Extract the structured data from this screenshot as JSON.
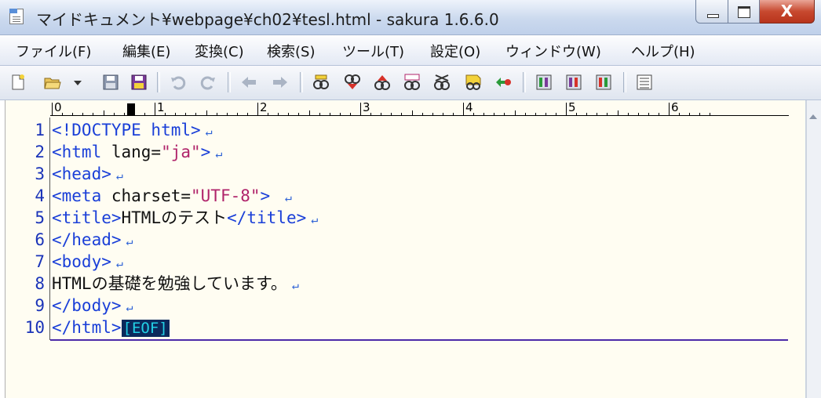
{
  "window": {
    "title": "マイドキュメント¥webpage¥ch02¥tesl.html - sakura 1.6.6.0",
    "close_glyph": "X"
  },
  "menu": [
    {
      "label": "ファイル(F)"
    },
    {
      "label": "編集(E)"
    },
    {
      "label": "変換(C)"
    },
    {
      "label": "検索(S)"
    },
    {
      "label": "ツール(T)"
    },
    {
      "label": "設定(O)"
    },
    {
      "label": "ウィンドウ(W)"
    },
    {
      "label": "ヘルプ(H)"
    }
  ],
  "toolbar": {
    "icons": [
      "new-file-icon",
      "open-folder-icon",
      "dropdown-arrow-icon",
      "save-icon",
      "save-all-icon",
      "undo-icon",
      "redo-icon",
      "back-icon",
      "forward-icon",
      "search-icon",
      "search-next-icon",
      "search-prev-icon",
      "replace-icon",
      "replace-all-icon",
      "grep-icon",
      "jump-icon",
      "tool1-icon",
      "tool2-icon",
      "tool3-icon",
      "outline-icon"
    ]
  },
  "ruler": {
    "labels": [
      "0",
      "1",
      "2",
      "3",
      "4",
      "5",
      "6"
    ]
  },
  "editor": {
    "line_numbers": [
      "1",
      "2",
      "3",
      "4",
      "5",
      "6",
      "7",
      "8",
      "9",
      "10"
    ],
    "lines": [
      {
        "tag": "<!DOCTYPE html>"
      },
      {
        "tag_open": "<html",
        "attr": " lang=",
        "str": "\"ja\"",
        "tag_close": ">"
      },
      {
        "tag": "<head>"
      },
      {
        "tag_open": "<meta",
        "attr": " charset=",
        "str": "\"UTF-8\"",
        "tag_close": "> "
      },
      {
        "tag_open": "<title>",
        "text": "HTMLのテスト",
        "tag_close": "</title>"
      },
      {
        "tag": "</head>"
      },
      {
        "tag": "<body>"
      },
      {
        "text": "HTMLの基礎を勉強しています。"
      },
      {
        "tag": "</body>"
      },
      {
        "tag": "</html>",
        "eof": "[EOF]"
      }
    ],
    "newline_mark": "↵"
  },
  "colors": {
    "tag": "#1a3fd8",
    "string": "#b0236a",
    "line_number": "#1a33b8",
    "background": "#fffdf2",
    "eof_bg": "#0b2a5c",
    "eof_fg": "#22d1e6"
  }
}
